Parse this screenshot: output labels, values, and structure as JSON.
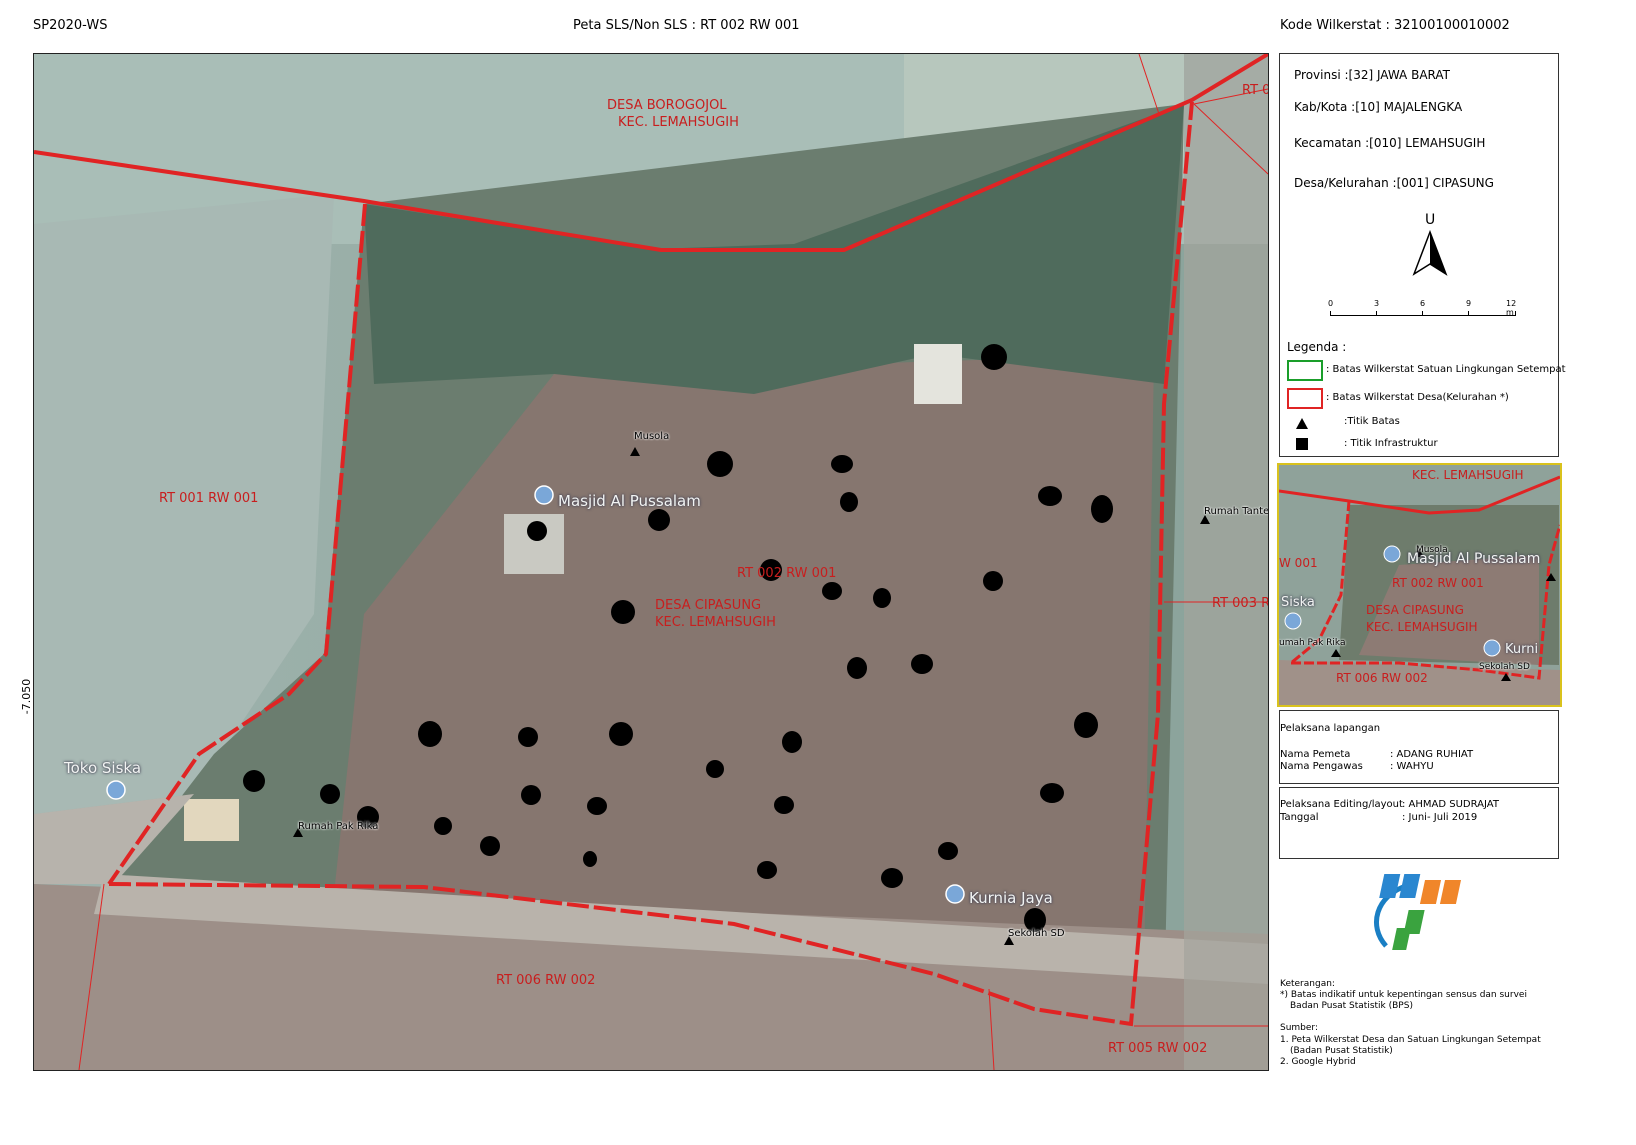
{
  "header": {
    "left": "SP2020-WS",
    "center": "Peta SLS/Non SLS : RT 002 RW 001",
    "right": "Kode Wilkerstat : 32100100010002"
  },
  "map": {
    "lat_label": "-7.050",
    "region_labels": [
      "DESA BOROGOJOL",
      "KEC. LEMAHSUGIH",
      "RT 0",
      "RT 001 RW 001",
      "RT 002 RW 001",
      "DESA CIPASUNG",
      "KEC. LEMAHSUGIH",
      "RT 003 R",
      "RT 006 RW 002",
      "RT 005 RW 002"
    ],
    "poi_labels": [
      "Musola",
      "Rumah Tante",
      "Rumah Pak Rika",
      "Sekolah SD"
    ],
    "google_labels": [
      "Masjid Al Pussalam",
      "Toko Siska",
      "Kurnia Jaya"
    ],
    "boundary_color": "#e02424"
  },
  "info": {
    "provinsi": "Provinsi :[32] JAWA BARAT",
    "kabkota": "Kab/Kota :[10] MAJALENGKA",
    "kecamatan": "Kecamatan :[010] LEMAHSUGIH",
    "desa": "Desa/Kelurahan :[001] CIPASUNG",
    "north": "U",
    "scale_ticks": [
      "0",
      "3",
      "6",
      "9",
      "12 m"
    ]
  },
  "legend": {
    "title": "Legenda :",
    "items": [
      {
        "text": ": Batas Wilkerstat Satuan Lingkungan Setempat",
        "color": "#1a9e2a"
      },
      {
        "text": ": Batas Wilkerstat Desa(Kelurahan *)",
        "color": "#e02424"
      },
      {
        "text": ":Titik Batas"
      },
      {
        "text": ": Titik Infrastruktur"
      }
    ]
  },
  "inset": {
    "labels": [
      "KEC. LEMAHSUGIH",
      "W 001",
      "Musola",
      "Masjid Al Pussalam",
      "RT 002 RW 001",
      "Siska",
      "DESA CIPASUNG",
      "KEC. LEMAHSUGIH",
      "umah Pak Rika",
      "Kurni",
      "Sekolah SD",
      "RT 006 RW 002"
    ]
  },
  "pelaksana": {
    "title": "Pelaksana lapangan",
    "pemeta_label": "Nama Pemeta",
    "pemeta_value": ":  ADANG RUHIAT",
    "pengawas_label": "Nama Pengawas",
    "pengawas_value": ":  WAHYU"
  },
  "editing": {
    "label": "Pelaksana Editing/layout",
    "value": ": AHMAD SUDRAJAT",
    "tanggal_label": "Tanggal",
    "tanggal_value": ": Juni- Juli 2019"
  },
  "notes": {
    "keterangan_title": "Keterangan:",
    "keterangan_1": "*) Batas indikatif untuk kepentingan sensus dan survei",
    "keterangan_2": "Badan Pusat Statistik (BPS)",
    "sumber_title": "Sumber:",
    "sumber_1": "1. Peta Wilkerstat Desa dan Satuan Lingkungan Setempat",
    "sumber_1b": "(Badan Pusat Statistik)",
    "sumber_2": "2. Google Hybrid"
  }
}
